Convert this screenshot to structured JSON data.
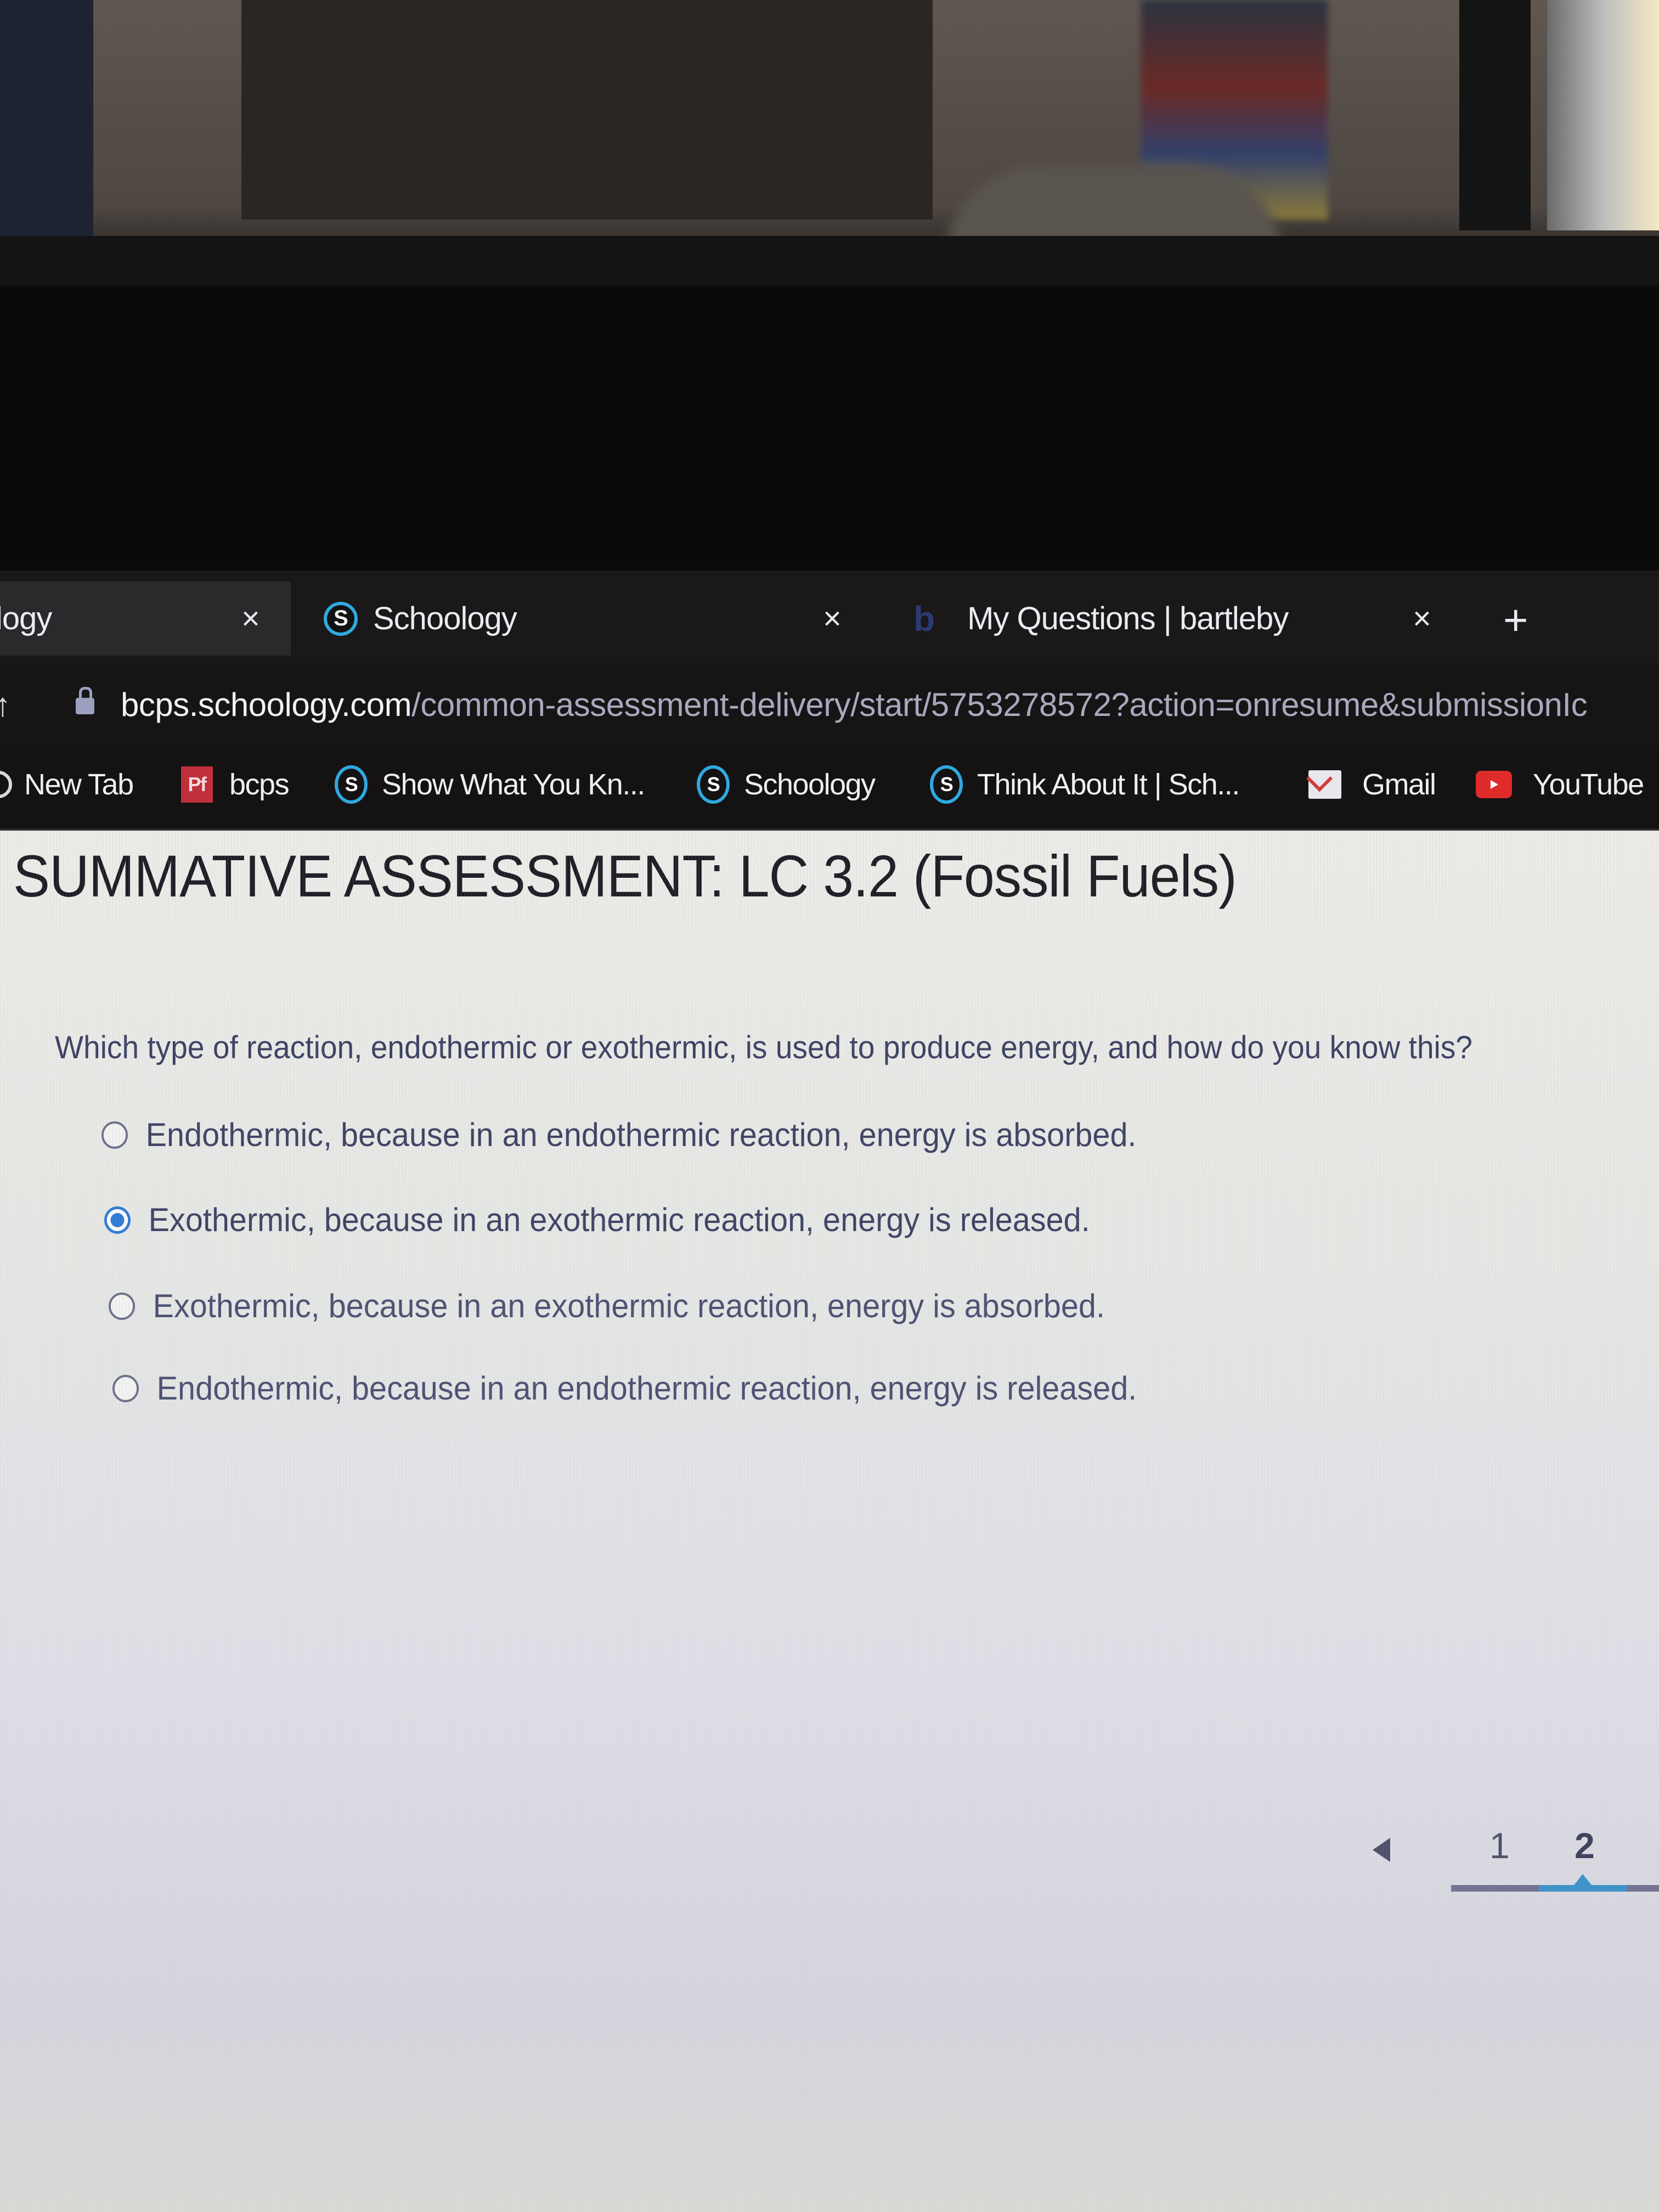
{
  "browser": {
    "tabs": [
      {
        "title": "logy",
        "favicon": "schoology-icon",
        "active": false,
        "close_label": "×"
      },
      {
        "title": "Schoology",
        "favicon": "schoology-icon",
        "active": true,
        "close_label": "×"
      },
      {
        "title": "My Questions | bartleby",
        "favicon": "bartleby-icon",
        "active": false,
        "close_label": "×"
      }
    ],
    "new_tab_label": "+",
    "address": {
      "host": "bcps.schoology.com",
      "path": "/common-assessment-delivery/start/5753278572?action=onresume&submissionIc"
    },
    "bookmarks": [
      {
        "label": "New Tab",
        "icon": "globe-icon"
      },
      {
        "label": "bcps",
        "icon": "pf-icon",
        "icon_text": "Pf"
      },
      {
        "label": "Show What You Kn...",
        "icon": "schoology-icon",
        "icon_text": "S"
      },
      {
        "label": "Schoology",
        "icon": "schoology-icon",
        "icon_text": "S"
      },
      {
        "label": "Think About It | Sch...",
        "icon": "schoology-icon",
        "icon_text": "S"
      },
      {
        "label": "Gmail",
        "icon": "gmail-icon"
      },
      {
        "label": "YouTube",
        "icon": "youtube-icon"
      }
    ]
  },
  "assessment": {
    "title": "SUMMATIVE ASSESSMENT: LC 3.2 (Fossil Fuels)",
    "question": "Which type of reaction, endothermic or exothermic, is used to produce energy, and how do you know this?",
    "options": [
      {
        "label": "Endothermic, because in an endothermic reaction, energy is absorbed.",
        "selected": false
      },
      {
        "label": "Exothermic, because in an exothermic reaction, energy is released.",
        "selected": true
      },
      {
        "label": "Exothermic, because in an exothermic reaction, energy is absorbed.",
        "selected": false
      },
      {
        "label": "Endothermic, because in an endothermic reaction, energy is released.",
        "selected": false
      }
    ],
    "pagination": {
      "pages": [
        "1",
        "2"
      ],
      "current_page": "2"
    }
  },
  "colors": {
    "schoology_blue": "#2eaadf",
    "radio_selected": "#2f7ad6",
    "pager_active": "#3b92c8"
  }
}
